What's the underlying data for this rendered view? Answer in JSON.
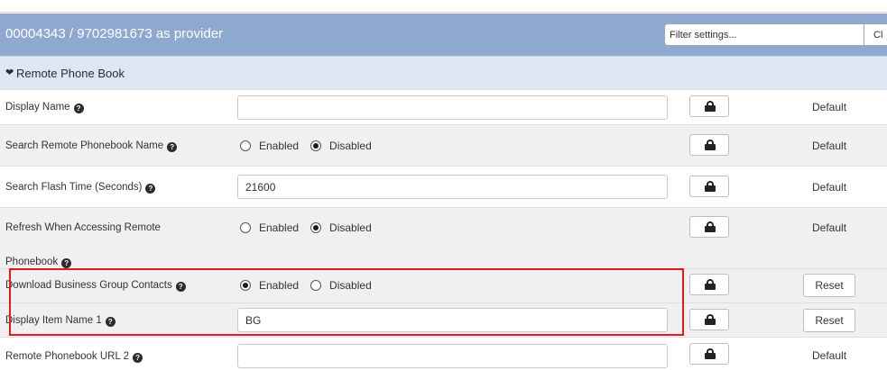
{
  "header": {
    "title": "00004343 / 9702981673 as provider",
    "filter_placeholder": "Filter settings...",
    "clear_label": "Cl"
  },
  "section": {
    "chevron": "❤",
    "title": "Remote Phone Book"
  },
  "help_glyph": "?",
  "lock_icon": "lock-icon",
  "highlight_color": "#e01b1b",
  "rows": [
    {
      "label": "Display Name",
      "type": "text",
      "value": "",
      "status": "Default"
    },
    {
      "label": "Search Remote Phonebook Name",
      "type": "radio",
      "options": [
        "Enabled",
        "Disabled"
      ],
      "selected": "Disabled",
      "status": "Default"
    },
    {
      "label": "Search Flash Time (Seconds)",
      "type": "text",
      "value": "21600",
      "status": "Default"
    },
    {
      "label_line1": "Refresh When Accessing Remote",
      "label_line2": "Phonebook",
      "type": "radio",
      "options": [
        "Enabled",
        "Disabled"
      ],
      "selected": "Disabled",
      "status": "Default"
    },
    {
      "label": "Download Business Group Contacts",
      "type": "radio",
      "options": [
        "Enabled",
        "Disabled"
      ],
      "selected": "Enabled",
      "status": "Reset"
    },
    {
      "label": "Display Item Name 1",
      "type": "text",
      "value": "BG",
      "status": "Reset"
    },
    {
      "label": "Remote Phonebook URL 2",
      "type": "text",
      "value": "",
      "status": "Default"
    }
  ]
}
